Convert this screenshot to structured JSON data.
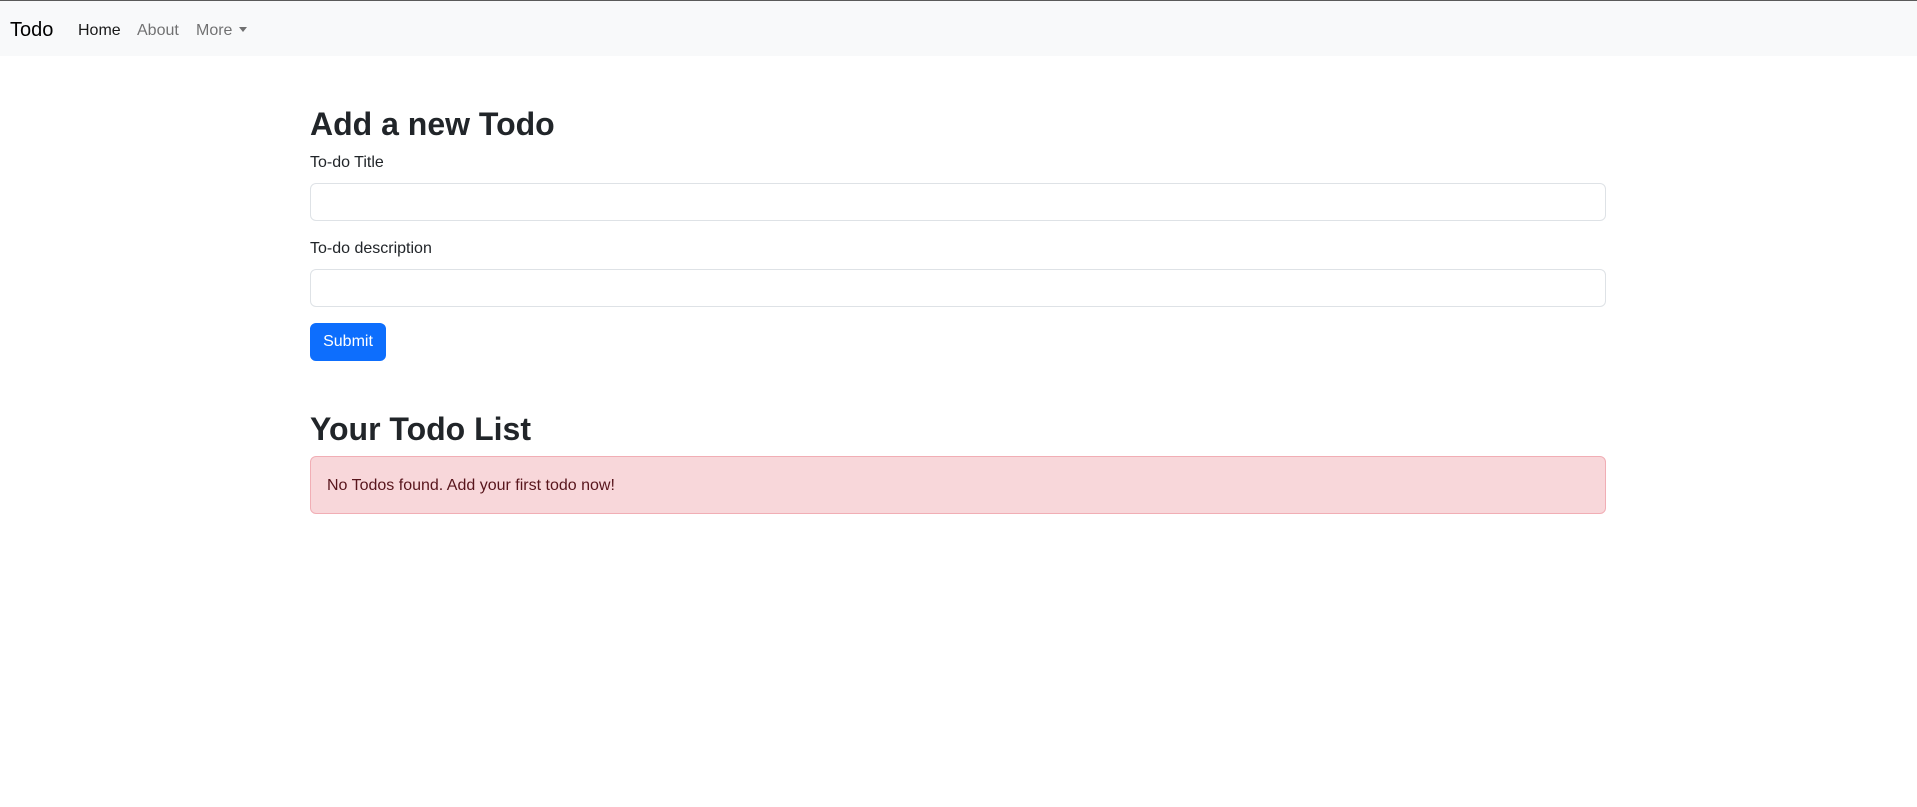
{
  "navbar": {
    "brand": "Todo",
    "links": [
      {
        "label": "Home",
        "active": true
      },
      {
        "label": "About",
        "active": false
      },
      {
        "label": "More",
        "active": false,
        "dropdown": true
      }
    ]
  },
  "form": {
    "heading": "Add a new Todo",
    "title_label": "To-do Title",
    "title_value": "",
    "description_label": "To-do description",
    "description_value": "",
    "submit_label": "Submit"
  },
  "list": {
    "heading": "Your Todo List",
    "empty_message": "No Todos found. Add your first todo now!"
  },
  "colors": {
    "navbar_bg": "#f8f9fa",
    "primary": "#0d6efd",
    "alert_bg": "#f8d7da",
    "alert_border": "#f1aeb5",
    "alert_text": "#58151c"
  }
}
